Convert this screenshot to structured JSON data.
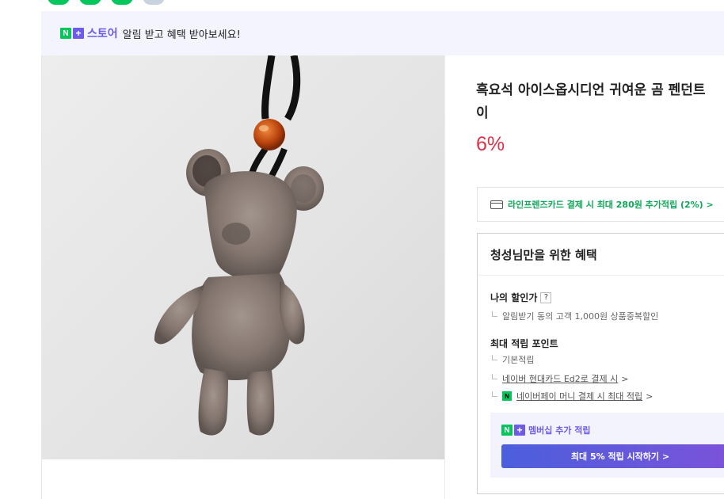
{
  "banner": {
    "n_label": "N",
    "plus_label": "+",
    "store_label": "스토어",
    "message": "알림 받고 혜택 받아보세요!"
  },
  "product": {
    "image_icon": "bear-pendant-photo",
    "title_line1": "흑요석 아이스옵시디언 귀여운 곰 펜던트",
    "title_line2": "이",
    "discount": "6%"
  },
  "card_promo": {
    "icon": "credit-card-icon",
    "text": "라인프렌즈카드 결제 시 최대 280원 추가적립 (2%) >"
  },
  "benefits": {
    "heading": "청성님만을 위한 혜택",
    "my_discount": {
      "label": "나의 할인가",
      "help_icon": "?",
      "detail": "알림받기 동의 고객 1,000원 상품중복할인"
    },
    "max_points": {
      "label": "최대 적립 포인트",
      "basic": "기본적립",
      "hyundai": "네이버 현대카드 Ed2로 결제 시",
      "hyundai_arrow": ">",
      "npay_badge": "N",
      "npay": "네이버페이 머니 결제 시 최대 적립",
      "npay_arrow": ">"
    },
    "membership": {
      "n_label": "N",
      "plus_label": "+",
      "title": "멤버십 추가 적립",
      "button": "최대 5% 적립 시작하기 >"
    }
  },
  "colors": {
    "brand_green": "#03c75a",
    "plus_purple": "#6c5ce7",
    "discount_red": "#e0314b",
    "card_green": "#0fa85a"
  }
}
